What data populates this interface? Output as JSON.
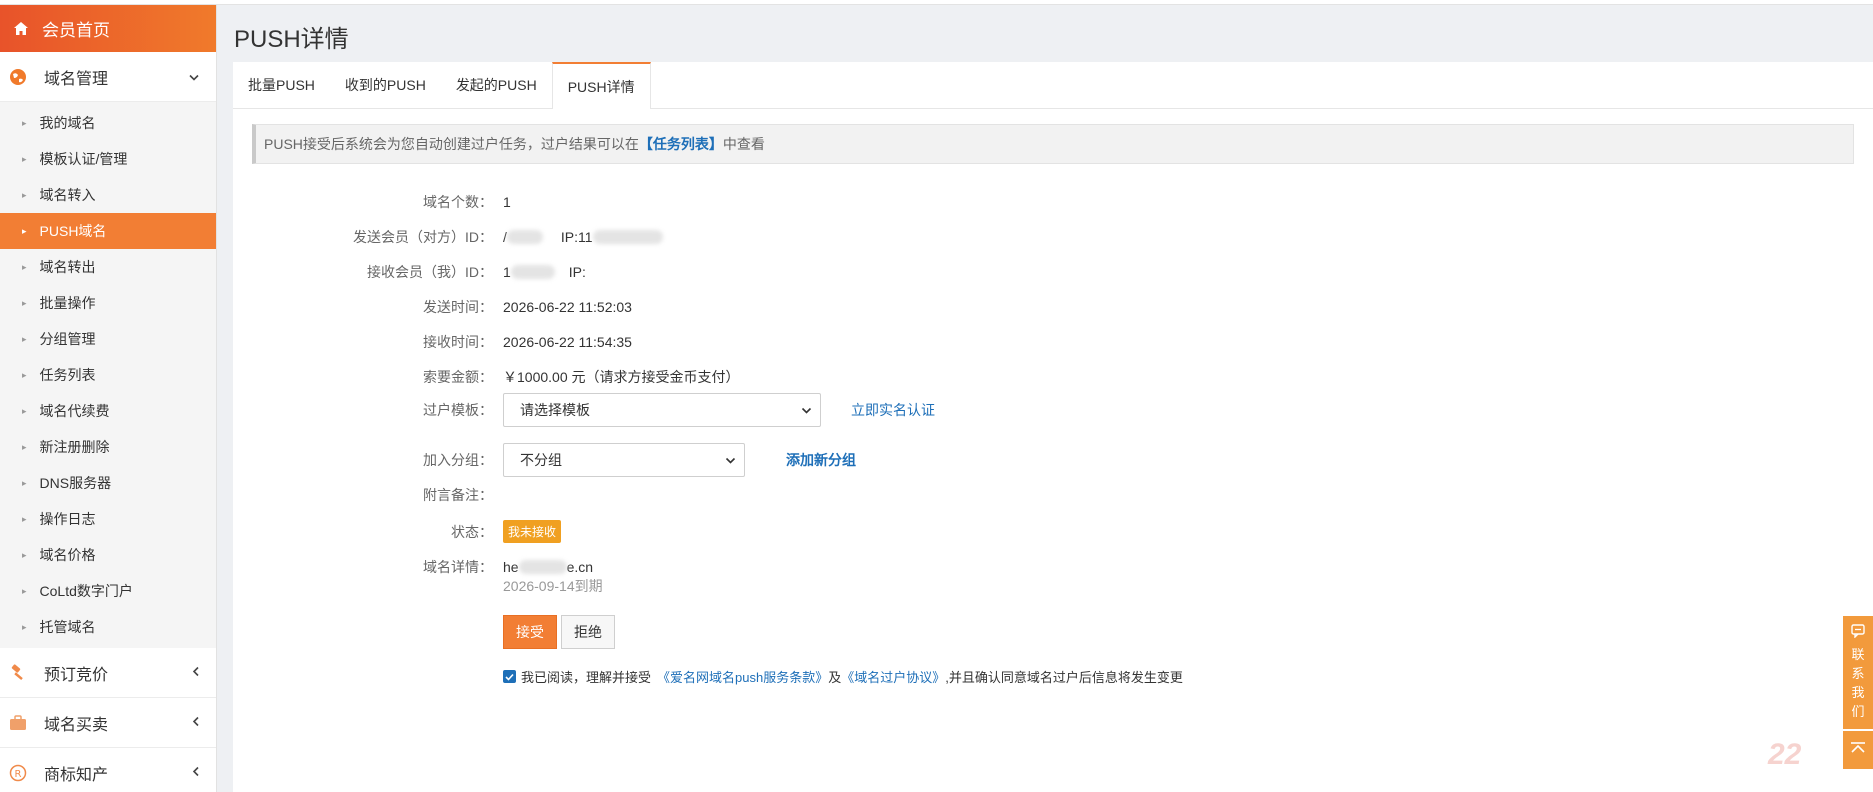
{
  "sidebar": {
    "home_label": "会员首页",
    "domain_group": "域名管理",
    "items": [
      {
        "label": "我的域名"
      },
      {
        "label": "模板认证/管理"
      },
      {
        "label": "域名转入"
      },
      {
        "label": "PUSH域名"
      },
      {
        "label": "域名转出"
      },
      {
        "label": "批量操作"
      },
      {
        "label": "分组管理"
      },
      {
        "label": "任务列表"
      },
      {
        "label": "域名代续费"
      },
      {
        "label": "新注册删除"
      },
      {
        "label": "DNS服务器"
      },
      {
        "label": "操作日志"
      },
      {
        "label": "域名价格"
      },
      {
        "label": "CoLtd数字门户"
      },
      {
        "label": "托管域名"
      }
    ],
    "groups_after": [
      {
        "label": "预订竞价"
      },
      {
        "label": "域名买卖"
      },
      {
        "label": "商标知产"
      }
    ],
    "active_item": "PUSH域名",
    "accent_color": "#f27e34"
  },
  "page": {
    "title": "PUSH详情",
    "tabs": [
      {
        "label": "批量PUSH"
      },
      {
        "label": "收到的PUSH"
      },
      {
        "label": "发起的PUSH"
      },
      {
        "label": "PUSH详情"
      }
    ],
    "active_tab": "PUSH详情",
    "notice_prefix": "PUSH接受后系统会为您自动创建过户任务，过户结果可以在",
    "notice_link": "【任务列表】",
    "notice_suffix": "中查看"
  },
  "detail": {
    "count_label": "域名个数：",
    "count_value": "1",
    "sender_label": "发送会员（对方）ID：",
    "sender_id_visible": "/",
    "sender_ip_label": "IP:11",
    "receiver_label": "接收会员（我）ID：",
    "receiver_id_visible": "1",
    "receiver_ip_label": "IP:",
    "send_time_label": "发送时间：",
    "send_time_value": "2026-06-22 11:52:03",
    "recv_time_label": "接收时间：",
    "recv_time_value": "2026-06-22 11:54:35",
    "amount_label": "索要金额：",
    "amount_value": "￥1000.00 元（请求方接受金币支付）",
    "template_label": "过户模板：",
    "template_select": "请选择模板",
    "template_link": "立即实名认证",
    "group_label": "加入分组：",
    "group_select": "不分组",
    "group_link": "添加新分组",
    "remark_label": "附言备注：",
    "status_label": "状态：",
    "status_badge": "我未接收",
    "domain_label": "域名详情：",
    "domain_prefix": "he",
    "domain_suffix": "e.cn",
    "domain_expiry": "2026-09-14到期",
    "accept_button": "接受",
    "reject_button": "拒绝",
    "agree_prefix": "我已阅读，理解并接受",
    "agree_link1": "《爱名网域名push服务条款》",
    "agree_mid": "及",
    "agree_link2": "《域名过户协议》",
    "agree_suffix": ",并且确认同意域名过户后信息将发生变更"
  },
  "float": {
    "contact": "联系我们",
    "watermark": "22"
  }
}
